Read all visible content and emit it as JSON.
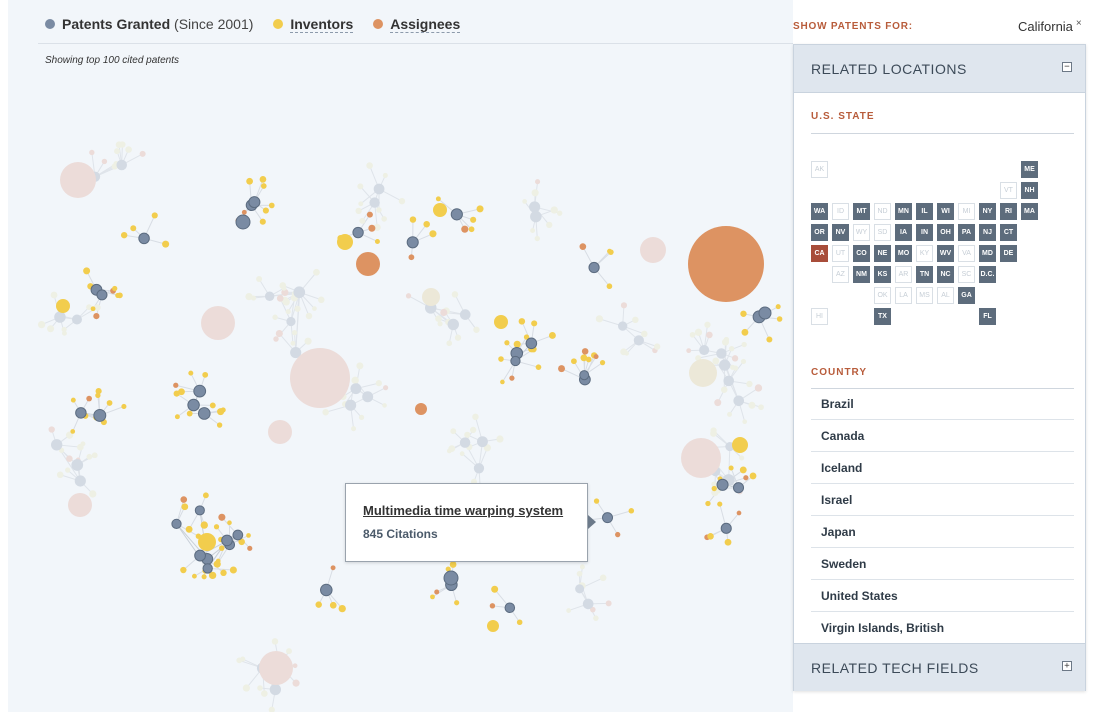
{
  "legend": {
    "patents_label": "Patents Granted",
    "patents_since": "(Since 2001)",
    "inventors_label": "Inventors",
    "assignees_label": "Assignees"
  },
  "showing_text": "Showing top 100 cited patents",
  "show_for": {
    "label": "SHOW PATENTS FOR:",
    "value": "California",
    "clear_icon": "close-icon"
  },
  "panel": {
    "related_locations": "RELATED LOCATIONS",
    "locations_toggle": "−",
    "state_label": "U.S. STATE",
    "country_label": "COUNTRY",
    "related_tech": "RELATED TECH FIELDS",
    "tech_toggle": "+"
  },
  "states": [
    {
      "code": "AK",
      "state": "off"
    },
    {
      "code": "ME",
      "state": "on"
    },
    {
      "code": "VT",
      "state": "off"
    },
    {
      "code": "NH",
      "state": "on"
    },
    {
      "code": "WA",
      "state": "on"
    },
    {
      "code": "ID",
      "state": "off"
    },
    {
      "code": "MT",
      "state": "on"
    },
    {
      "code": "ND",
      "state": "off"
    },
    {
      "code": "MN",
      "state": "on"
    },
    {
      "code": "IL",
      "state": "on"
    },
    {
      "code": "WI",
      "state": "on"
    },
    {
      "code": "MI",
      "state": "off"
    },
    {
      "code": "NY",
      "state": "on"
    },
    {
      "code": "RI",
      "state": "on"
    },
    {
      "code": "MA",
      "state": "on"
    },
    {
      "code": "OR",
      "state": "on"
    },
    {
      "code": "NV",
      "state": "on"
    },
    {
      "code": "WY",
      "state": "off"
    },
    {
      "code": "SD",
      "state": "off"
    },
    {
      "code": "IA",
      "state": "on"
    },
    {
      "code": "IN",
      "state": "on"
    },
    {
      "code": "OH",
      "state": "on"
    },
    {
      "code": "PA",
      "state": "on"
    },
    {
      "code": "NJ",
      "state": "on"
    },
    {
      "code": "CT",
      "state": "on"
    },
    {
      "code": "CA",
      "state": "sel"
    },
    {
      "code": "UT",
      "state": "off"
    },
    {
      "code": "CO",
      "state": "on"
    },
    {
      "code": "NE",
      "state": "on"
    },
    {
      "code": "MO",
      "state": "on"
    },
    {
      "code": "KY",
      "state": "off"
    },
    {
      "code": "WV",
      "state": "on"
    },
    {
      "code": "VA",
      "state": "off"
    },
    {
      "code": "MD",
      "state": "on"
    },
    {
      "code": "DE",
      "state": "on"
    },
    {
      "code": "AZ",
      "state": "off"
    },
    {
      "code": "NM",
      "state": "on"
    },
    {
      "code": "KS",
      "state": "on"
    },
    {
      "code": "AR",
      "state": "off"
    },
    {
      "code": "TN",
      "state": "on"
    },
    {
      "code": "NC",
      "state": "on"
    },
    {
      "code": "SC",
      "state": "off"
    },
    {
      "code": "D.C.",
      "state": "on"
    },
    {
      "code": "OK",
      "state": "off"
    },
    {
      "code": "LA",
      "state": "off"
    },
    {
      "code": "MS",
      "state": "off"
    },
    {
      "code": "AL",
      "state": "off"
    },
    {
      "code": "GA",
      "state": "on"
    },
    {
      "code": "HI",
      "state": "off"
    },
    {
      "code": "TX",
      "state": "on"
    },
    {
      "code": "FL",
      "state": "on"
    }
  ],
  "countries": [
    "Brazil",
    "Canada",
    "Iceland",
    "Israel",
    "Japan",
    "Sweden",
    "United States",
    "Virgin Islands, British"
  ],
  "tooltip": {
    "title": "Multimedia time warping system",
    "citations": "845 Citations"
  },
  "colors": {
    "patent": "#7a8ba3",
    "inventor": "#f2cd4d",
    "assignee": "#dd9362",
    "selected_state": "#a84d3a",
    "active_state": "#5d6c7c",
    "accent_label": "#b85c3b",
    "faded_blue": "#d3dae3",
    "faded_pink": "#ecdcd9",
    "faded_cream": "#ece8d8"
  }
}
